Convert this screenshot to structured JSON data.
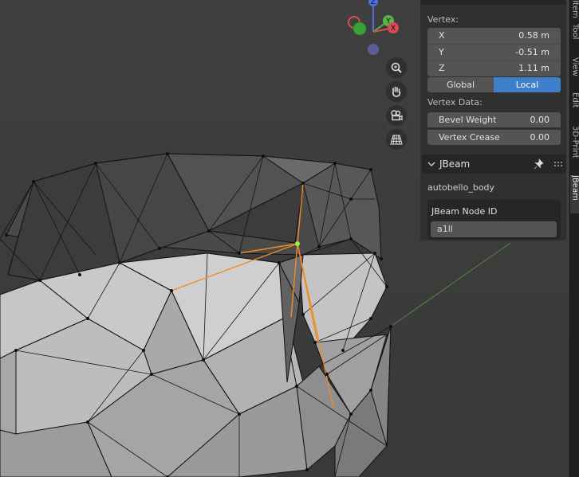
{
  "sidebar_tabs": [
    {
      "label": "Item",
      "active": false
    },
    {
      "label": "Tool",
      "active": false
    },
    {
      "label": "View",
      "active": false
    },
    {
      "label": "Edit",
      "active": false
    },
    {
      "label": "3D-Print",
      "active": false
    },
    {
      "label": "JBeam",
      "active": true
    }
  ],
  "gizmo": {
    "z": "Z",
    "y": "Y",
    "x": "X"
  },
  "item_panel": {
    "vertex_label": "Vertex:",
    "x_label": "X",
    "x_value": "0.58 m",
    "y_label": "Y",
    "y_value": "-0.51 m",
    "z_label": "Z",
    "z_value": "1.11 m",
    "global_label": "Global",
    "local_label": "Local",
    "vertex_data_label": "Vertex Data:",
    "bevel_weight_label": "Bevel Weight",
    "bevel_weight_value": "0.00",
    "vertex_crease_label": "Vertex Crease",
    "vertex_crease_value": "0.00"
  },
  "jbeam_panel": {
    "title": "JBeam",
    "object_name": "autobello_body",
    "node_id_label": "JBeam Node ID",
    "node_id_value": "a1ll"
  },
  "colors": {
    "accent_blue": "#3d7fc8",
    "edge_selected": "#f08a24",
    "vertex_active": "#7dff4a",
    "axis_x": "#d94a52",
    "axis_y": "#5ab34a",
    "axis_z": "#4a6fd9"
  }
}
